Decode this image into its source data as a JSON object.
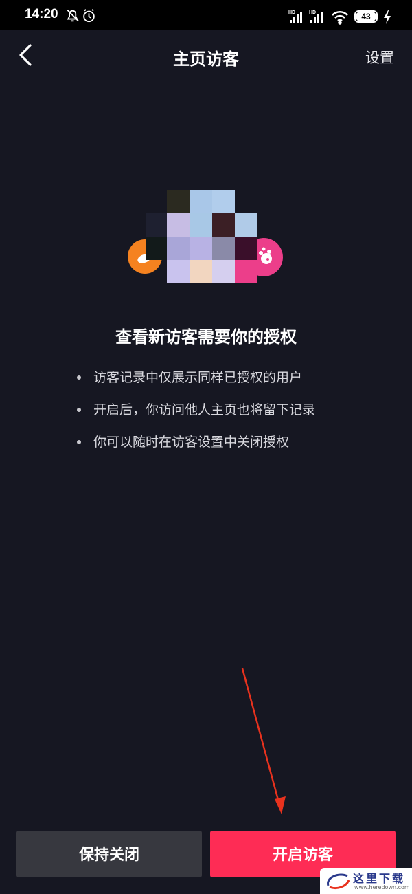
{
  "status_bar": {
    "time": "14:20",
    "battery_level": "43",
    "network_labels": [
      "HD",
      "HD"
    ],
    "icons": [
      "mute-bell-icon",
      "alarm-icon",
      "signal-icon",
      "signal-icon",
      "wifi-icon",
      "battery-icon",
      "charging-icon"
    ]
  },
  "nav": {
    "title": "主页访客",
    "settings_label": "设置",
    "back_icon": "chevron-left-icon"
  },
  "content": {
    "headline": "查看新访客需要你的授权",
    "bullets": [
      "访客记录中仅展示同样已授权的用户",
      "开启后，你访问他人主页也将留下记录",
      "你可以随时在访客设置中关闭授权"
    ]
  },
  "actions": {
    "keep_closed_label": "保持关闭",
    "enable_visitors_label": "开启访客"
  },
  "watermark": {
    "text": "这里下载",
    "url": "www.heredown.com"
  },
  "colors": {
    "background": "#161722",
    "primary": "#fe2c55",
    "secondary_button": "#37383f",
    "annotation_arrow": "#e8321e"
  }
}
